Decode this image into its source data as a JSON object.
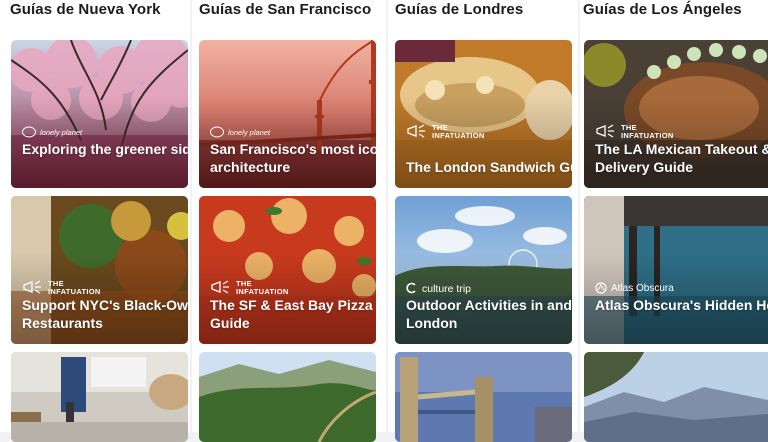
{
  "columns": [
    {
      "title": "Guías de Nueva York",
      "cards": [
        {
          "brand": "lonely planet",
          "brand_icon": "lonely-planet-logo",
          "title": "Exploring the greener side of Brooklyn"
        },
        {
          "brand": "THE INFATUATION",
          "brand_icon": "infatuation-megaphone-icon",
          "title": "Support NYC's Black-Owned Restaurants"
        },
        {
          "title": ""
        }
      ]
    },
    {
      "title": "Guías de San Francisco",
      "cards": [
        {
          "brand": "lonely planet",
          "brand_icon": "lonely-planet-logo",
          "title": "San Francisco's most iconic architecture"
        },
        {
          "brand": "THE INFATUATION",
          "brand_icon": "infatuation-megaphone-icon",
          "title": "The SF & East Bay Pizza Delivery Guide"
        },
        {
          "title": ""
        }
      ]
    },
    {
      "title": "Guías de Londres",
      "cards": [
        {
          "brand": "THE INFATUATION",
          "brand_icon": "infatuation-megaphone-icon",
          "title": "The London Sandwich Guide"
        },
        {
          "brand": "culture trip",
          "brand_icon": "culture-trip-logo",
          "title": "Outdoor Activities in and Around London"
        },
        {
          "title": ""
        }
      ]
    },
    {
      "title": "Guías de Los Ángeles",
      "cards": [
        {
          "brand": "THE INFATUATION",
          "brand_icon": "infatuation-megaphone-icon",
          "title": "The LA Mexican Takeout & Delivery Guide"
        },
        {
          "brand": "Atlas Obscura",
          "brand_icon": "atlas-obscura-logo",
          "title": "Atlas Obscura's Hidden Ho"
        },
        {
          "title": ""
        }
      ]
    }
  ],
  "colors": {
    "page_bg": "#f2f2f4",
    "title_text": "#1c1c1e",
    "card_text": "#ffffff"
  }
}
